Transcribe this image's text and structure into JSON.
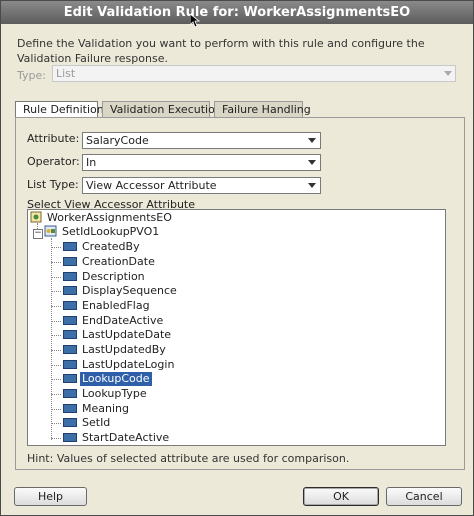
{
  "dialog": {
    "title": "Edit Validation Rule for: WorkerAssignmentsEO",
    "description": "Define the Validation you want to perform with this rule and configure the Validation Failure response."
  },
  "type_field": {
    "label": "Type:",
    "value": "List",
    "enabled": false
  },
  "tabs": [
    {
      "label": "Rule Definition",
      "active": true
    },
    {
      "label": "Validation Execution",
      "active": false
    },
    {
      "label": "Failure Handling",
      "active": false
    }
  ],
  "rule_definition": {
    "attribute": {
      "label": "Attribute:",
      "value": "SalaryCode"
    },
    "operator": {
      "label": "Operator:",
      "value": "In"
    },
    "list_type": {
      "label": "List Type:",
      "value": "View Accessor Attribute"
    },
    "tree_label": "Select View Accessor Attribute",
    "tree": {
      "root": "WorkerAssignmentsEO",
      "accessor": "SetIdLookupPVO1",
      "attributes": [
        "CreatedBy",
        "CreationDate",
        "Description",
        "DisplaySequence",
        "EnabledFlag",
        "EndDateActive",
        "LastUpdateDate",
        "LastUpdatedBy",
        "LastUpdateLogin",
        "LookupCode",
        "LookupType",
        "Meaning",
        "SetId",
        "StartDateActive"
      ],
      "selected": "LookupCode"
    },
    "hint": "Hint: Values of selected attribute are used for comparison."
  },
  "buttons": {
    "help": "Help",
    "ok": "OK",
    "cancel": "Cancel"
  },
  "icons": {
    "entity_object": "entity-object-icon",
    "view_object": "view-object-icon",
    "attribute": "attribute-icon"
  },
  "colors": {
    "title_bar": "#6e6e6e",
    "selection": "#2f5fa8",
    "dialog_bg": "#ece9d8"
  }
}
